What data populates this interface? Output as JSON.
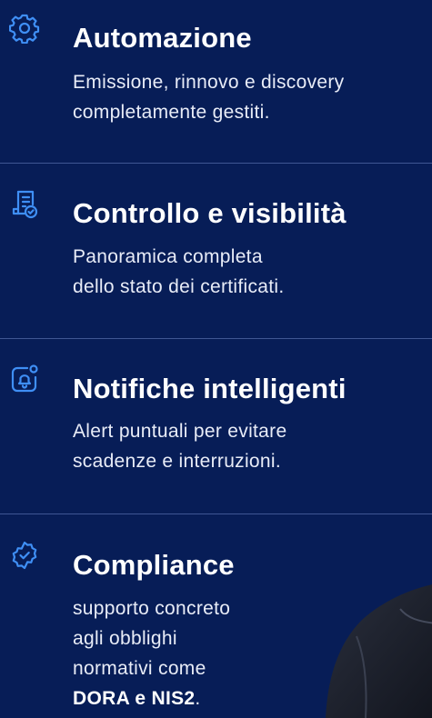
{
  "features": [
    {
      "icon": "gear-icon",
      "title": "Automazione",
      "desc_lines": [
        "Emissione, rinnovo e discovery",
        "completamente gestiti."
      ]
    },
    {
      "icon": "certificate-list-icon",
      "title": "Controllo e visibilità",
      "desc_lines": [
        "Panoramica completa",
        "dello stato dei certificati."
      ]
    },
    {
      "icon": "notification-bell-icon",
      "title": "Notifiche intelligenti",
      "desc_lines": [
        "Alert puntuali per evitare",
        "scadenze e interruzioni."
      ]
    },
    {
      "icon": "shield-check-icon",
      "title": "Compliance",
      "desc_lines": [
        "supporto concreto",
        "agli obblighi",
        "normativi come"
      ],
      "desc_bold": "DORA e NIS2",
      "desc_tail": "."
    }
  ],
  "colors": {
    "background": "#071d57",
    "icon": "#3f8ff5",
    "divider": "#3f5693",
    "text": "#ffffff"
  }
}
